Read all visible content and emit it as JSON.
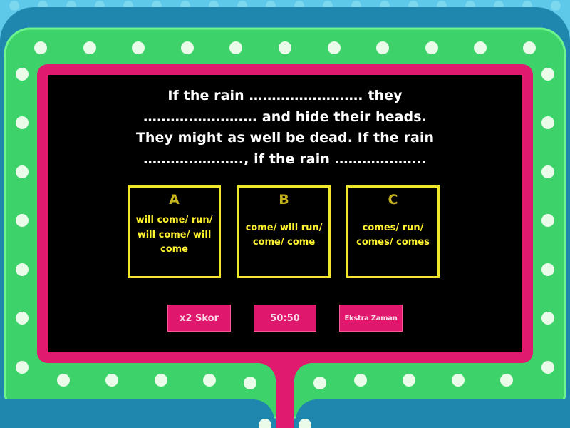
{
  "question": {
    "lines": [
      "If the rain ……………………. they",
      "……………………. and hide their heads.",
      "They might as well be dead. If the rain",
      "…………………., if the rain ……………….."
    ]
  },
  "answers": [
    {
      "letter": "A",
      "text": "will come/ run/ will come/ will come"
    },
    {
      "letter": "B",
      "text": "come/ will run/ come/ come"
    },
    {
      "letter": "C",
      "text": "comes/ run/ comes/ comes"
    }
  ],
  "lifelines": {
    "double_score": "x2 Skor",
    "fifty_fifty": "50:50",
    "extra_time": "Ekstra Zaman"
  },
  "colors": {
    "sky": "#5ec9e8",
    "teal_frame": "#1f86ad",
    "green_frame": "#3ed36a",
    "magenta_frame": "#df1a6f",
    "screen": "#000000",
    "answer_border": "#f2e62c",
    "answer_letter": "#c3b21c",
    "answer_text": "#fff22e",
    "lifeline_button": "#e0186d"
  }
}
